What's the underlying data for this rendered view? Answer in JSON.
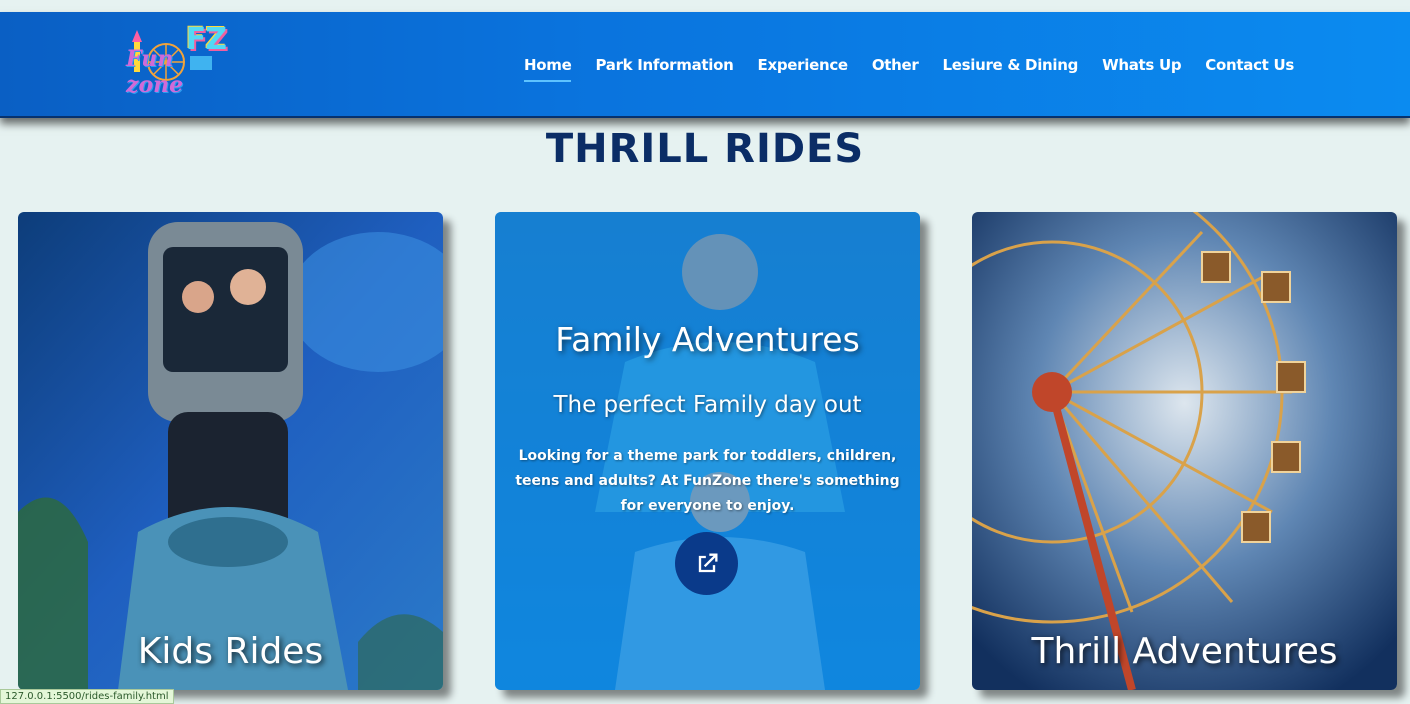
{
  "header": {
    "logo_mark": "FZ",
    "logo_text": "Fun zone",
    "nav": [
      {
        "label": "Home",
        "active": true
      },
      {
        "label": "Park Information",
        "active": false
      },
      {
        "label": "Experience",
        "active": false
      },
      {
        "label": "Other",
        "active": false
      },
      {
        "label": "Lesiure & Dining",
        "active": false
      },
      {
        "label": "Whats Up",
        "active": false
      },
      {
        "label": "Contact Us",
        "active": false
      }
    ]
  },
  "main": {
    "title": "THRILL RIDES",
    "cards": [
      {
        "title": "Kids Rides"
      },
      {
        "title": "Family Adventures",
        "subtitle": "The perfect Family day out",
        "description": "Looking for a theme park for toddlers, children, teens and adults? At FunZone there's something for everyone to enjoy.",
        "link_icon": "external-link-icon"
      },
      {
        "title": "Thrill Adventures"
      }
    ]
  },
  "status_bar": {
    "url": "127.0.0.1:5500/rides-family.html"
  },
  "colors": {
    "nav_start": "#0a5fc4",
    "nav_end": "#0b8bf0",
    "title": "#0b2d66",
    "background": "#e6f2f1",
    "button": "#0a3a8a"
  }
}
